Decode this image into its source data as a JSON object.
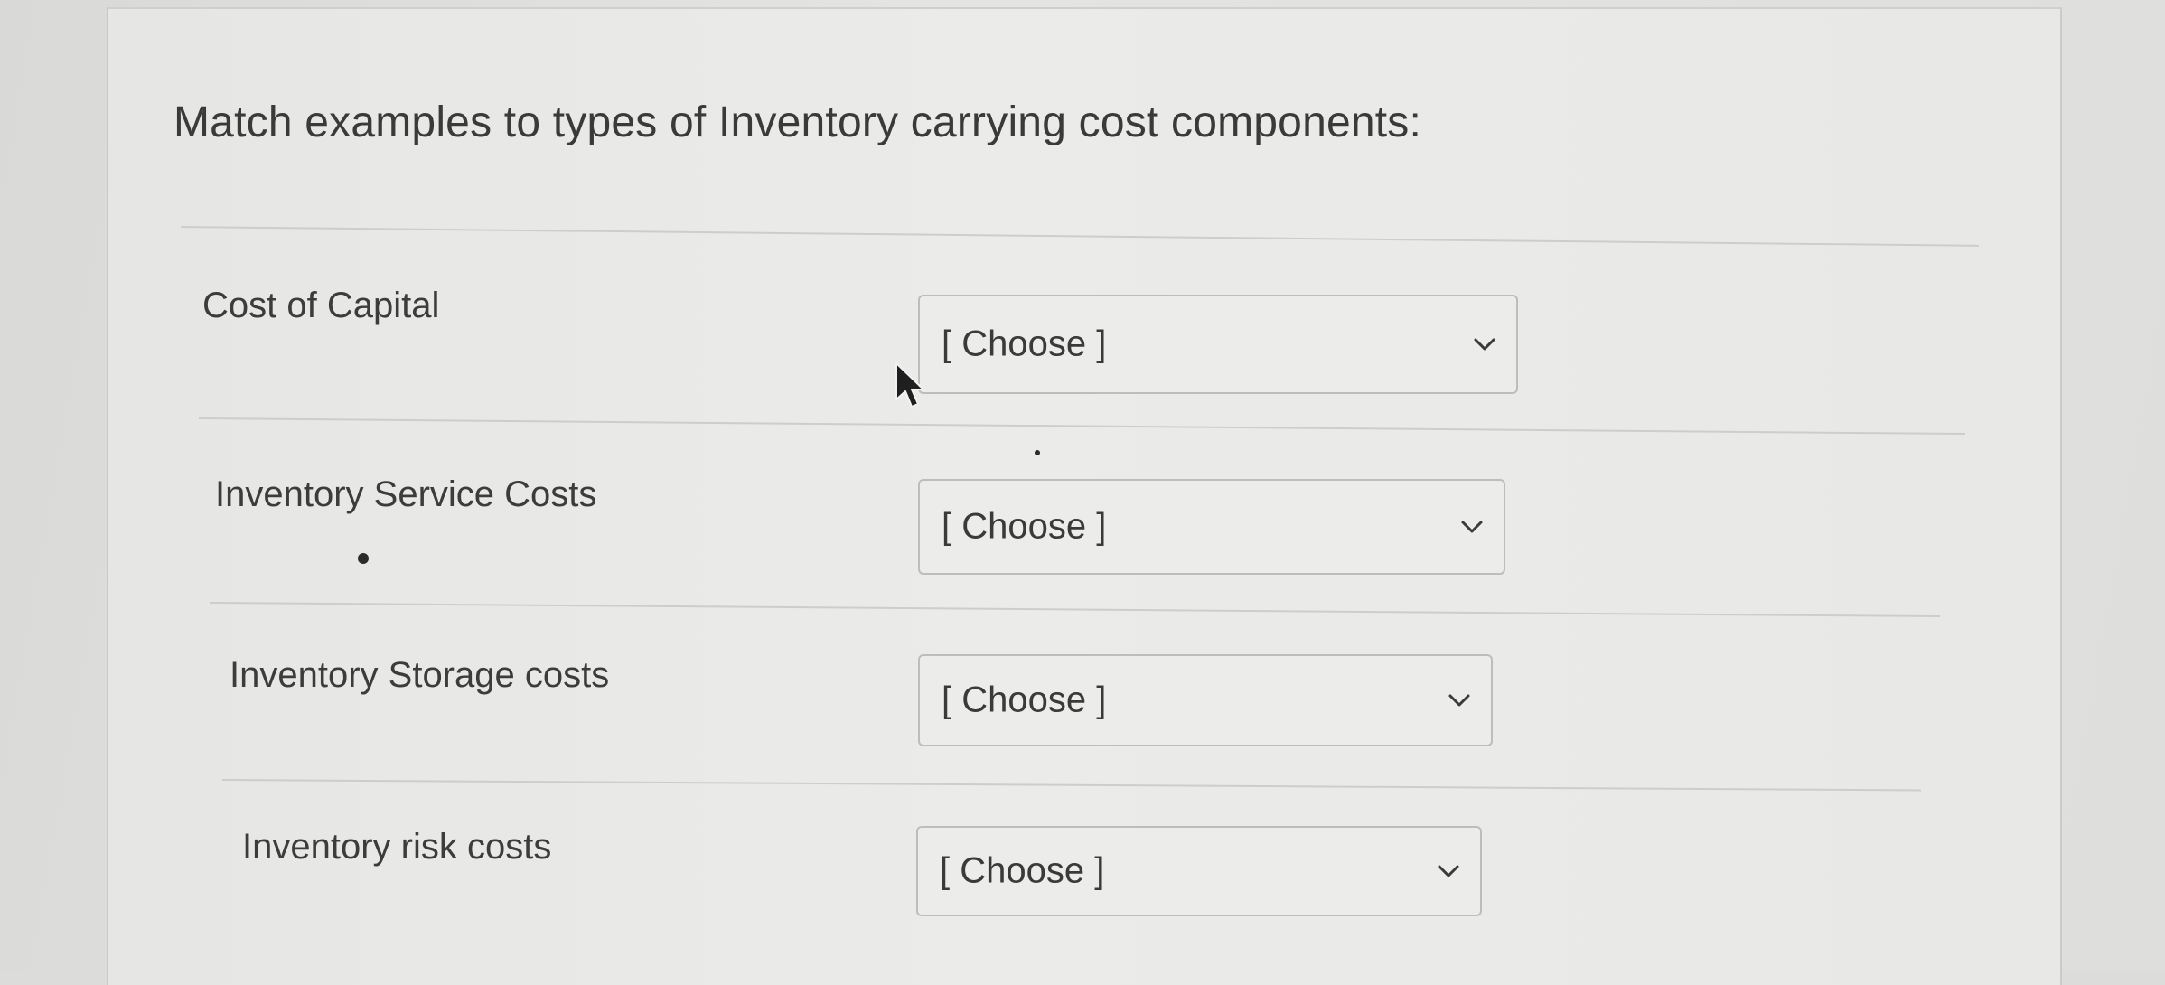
{
  "quiz": {
    "prompt": "Match examples to types of Inventory carrying cost components:",
    "rows": [
      {
        "label": "Cost of Capital",
        "selected": "[ Choose ]"
      },
      {
        "label": "Inventory Service Costs",
        "selected": "[ Choose ]"
      },
      {
        "label": "Inventory Storage costs",
        "selected": "[ Choose ]"
      },
      {
        "label": "Inventory risk costs",
        "selected": "[ Choose ]"
      }
    ]
  },
  "icons": {
    "dropdown": "chevron-down-icon",
    "pointer": "mouse-pointer-icon"
  },
  "colors": {
    "background": "#e8e8e6",
    "text": "#3a3a3a",
    "border": "#bdbdbb"
  }
}
